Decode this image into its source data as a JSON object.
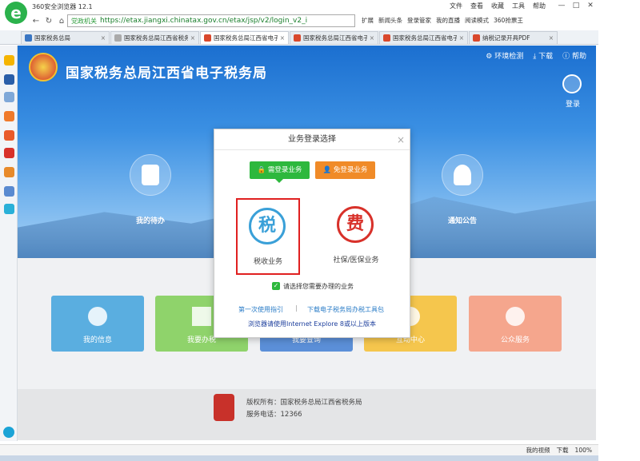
{
  "browser": {
    "title": "360安全浏览器 12.1",
    "menu": [
      "文件",
      "查看",
      "收藏",
      "工具",
      "帮助"
    ],
    "window_controls": [
      "—",
      "□",
      "✕"
    ],
    "url_badge": "党政机关",
    "url": "https://etax.jiangxi.chinatax.gov.cn/etax/jsp/v2/login_v2_i",
    "extensions": [
      "扩展",
      "新闻头条",
      "登录管家",
      "我的直播",
      "阅读模式",
      "360抢票王"
    ],
    "tabs": [
      {
        "label": "国家税务总局",
        "active": false
      },
      {
        "label": "国家税务总局江西省税务",
        "active": false
      },
      {
        "label": "国家税务总局江西省电子",
        "active": true
      },
      {
        "label": "国家税务总局江西省电子",
        "active": false
      },
      {
        "label": "国家税务总局江西省电子",
        "active": false
      },
      {
        "label": "纳税记录开具PDF",
        "active": false
      }
    ]
  },
  "site": {
    "title": "国家税务总局江西省电子税务局",
    "top_links": [
      "环境检测",
      "下载",
      "帮助"
    ],
    "login_label": "登录",
    "circles": [
      {
        "label": "我的待办"
      },
      {
        "label": "通知公告"
      }
    ],
    "cards": [
      {
        "label": "我的信息",
        "color": "#5aaee0"
      },
      {
        "label": "我要办税",
        "color": "#8fd36b"
      },
      {
        "label": "我要查询",
        "color": "#5b8fd8"
      },
      {
        "label": "互动中心",
        "color": "#f5c64d"
      },
      {
        "label": "公众服务",
        "color": "#f5a68d"
      }
    ],
    "footer": {
      "copyright": "版权所有：国家税务总局江西省税务局",
      "phone": "服务电话：12366"
    }
  },
  "modal": {
    "title": "业务登录选择",
    "btn_need_cert": "需登录业务",
    "btn_no_cert": "免登录业务",
    "option_tax": {
      "icon": "税",
      "label": "税收业务"
    },
    "option_social": {
      "icon": "费",
      "label": "社保/医保业务"
    },
    "checkbox_label": "请选择您需要办理的业务",
    "link_guide": "第一次使用指引",
    "link_tool": "下载电子税务局办税工具包",
    "link_ie": "浏览器请使用Internet Explore 8或以上版本"
  },
  "status": {
    "items": [
      "我的视频",
      "下载",
      "100%"
    ]
  }
}
